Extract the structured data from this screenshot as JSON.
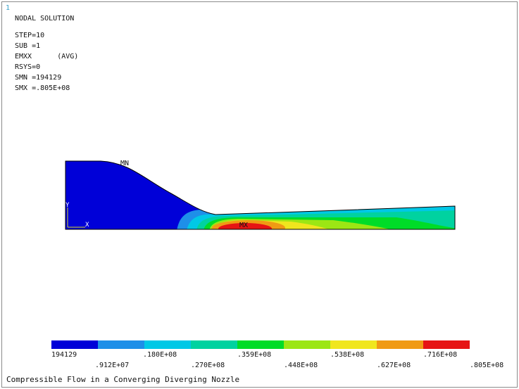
{
  "window": {
    "corner_mark": "1"
  },
  "info": {
    "lines": [
      "NODAL SOLUTION",
      "STEP=10",
      "SUB =1",
      "EMXX      (AVG)",
      "RSYS=0",
      "SMN =194129",
      "SMX =.805E+08"
    ]
  },
  "annotations": {
    "mn": "MN",
    "mx": "MX",
    "y_axis": "Y",
    "x_axis": "X"
  },
  "contour": {
    "colors": [
      "#0000d8",
      "#1e8fe8",
      "#00c8e6",
      "#00d2a0",
      "#00dc28",
      "#9ce614",
      "#f0e61e",
      "#f09a14",
      "#e61414"
    ]
  },
  "legend": {
    "colors": [
      "#0000d8",
      "#1e8fe8",
      "#00c8e6",
      "#00d2a0",
      "#00dc28",
      "#9ce614",
      "#f0e61e",
      "#f09a14",
      "#e61414"
    ],
    "labels_top": [
      "194129",
      ".180E+08",
      ".359E+08",
      ".538E+08",
      ".716E+08"
    ],
    "labels_bottom": [
      ".912E+07",
      ".270E+08",
      ".448E+08",
      ".627E+08",
      ".805E+08"
    ]
  },
  "footer": {
    "title": "Compressible Flow in a Converging Diverging Nozzle"
  }
}
